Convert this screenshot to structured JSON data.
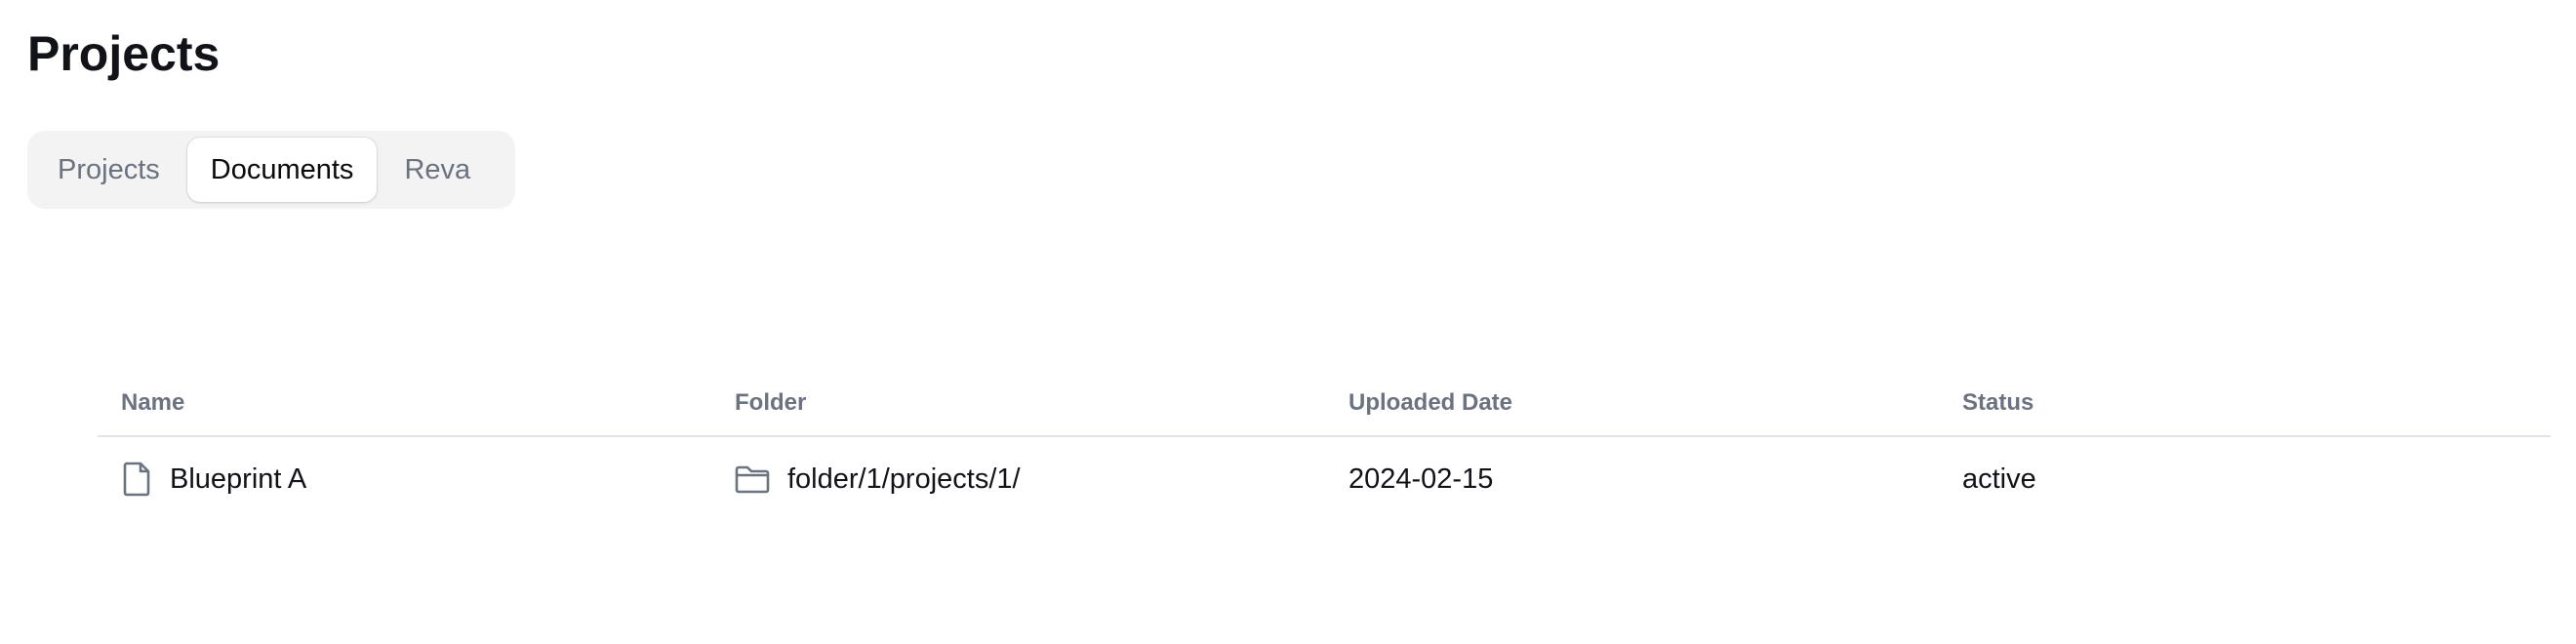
{
  "page": {
    "title": "Projects"
  },
  "tabs": [
    {
      "label": "Projects",
      "active": false
    },
    {
      "label": "Documents",
      "active": true
    },
    {
      "label": "Reva",
      "active": false
    }
  ],
  "table": {
    "columns": [
      "Name",
      "Folder",
      "Uploaded Date",
      "Status"
    ],
    "rows": [
      {
        "name": "Blueprint A",
        "name_icon": "file-icon",
        "folder": "folder/1/projects/1/",
        "folder_icon": "folder-icon",
        "uploaded_date": "2024-02-15",
        "status": "active"
      }
    ]
  },
  "colors": {
    "tab_bar_bg": "#f3f3f4",
    "active_tab_bg": "#ffffff",
    "muted_text": "#6b7280",
    "divider": "#e2e4e8"
  }
}
